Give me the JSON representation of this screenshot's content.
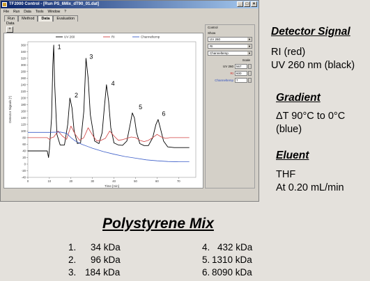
{
  "window": {
    "title": "TF2000 Control - [Run PS_6Mix_dT90_01.dat]",
    "menu": [
      "File",
      "Run",
      "Data",
      "Tools",
      "Window",
      "?"
    ],
    "tabs": [
      "Run",
      "Method",
      "Data",
      "Evaluation"
    ],
    "active_tab": "Data",
    "subtab": "Data",
    "tool_button": "+"
  },
  "control": {
    "title": "Control",
    "show_label": "Show",
    "dropdowns": [
      "UV 260",
      "RI",
      "Channeltemp"
    ],
    "scale_label": "Scale",
    "scales": [
      {
        "name": "UV 260",
        "value": "567",
        "color": "#000000"
      },
      {
        "name": "RI",
        "value": "600",
        "color": "#cc2020"
      },
      {
        "name": "Channeltemp",
        "value": "7",
        "color": "#3050c0"
      }
    ]
  },
  "chart_data": {
    "type": "line",
    "legend": [
      "UV 260",
      "RI",
      "Channeltemp"
    ],
    "legend_position": "top",
    "xlabel": "Time [min]",
    "ylabel": "Detector Signals [*]",
    "xlim": [
      0,
      78
    ],
    "ylim": [
      -40,
      370
    ],
    "xticks": [
      0,
      10,
      20,
      30,
      40,
      50,
      60,
      70
    ],
    "yticks": [
      -40,
      -20,
      0,
      20,
      40,
      60,
      80,
      100,
      120,
      140,
      160,
      180,
      200,
      220,
      240,
      260,
      280,
      300,
      320,
      340,
      360
    ],
    "grid": false,
    "series": [
      {
        "name": "UV 260",
        "color": "#000000",
        "x": [
          0,
          9,
          9.6,
          10,
          11,
          11.6,
          12,
          12.4,
          13.5,
          15,
          17,
          18.5,
          19.5,
          20.5,
          21.5,
          23,
          24.5,
          26,
          27,
          28,
          29,
          31,
          33,
          34.5,
          35.5,
          36.5,
          37.5,
          38.5,
          40,
          42,
          44,
          46,
          47.5,
          48.5,
          49.5,
          50.5,
          52,
          54,
          56,
          58,
          59.5,
          60.5,
          61.5,
          63,
          65,
          68,
          72,
          75
        ],
        "y": [
          40,
          40,
          20,
          45,
          140,
          300,
          360,
          250,
          90,
          58,
          58,
          120,
          200,
          170,
          100,
          62,
          65,
          160,
          320,
          260,
          150,
          70,
          62,
          95,
          170,
          240,
          190,
          110,
          64,
          58,
          57,
          70,
          120,
          155,
          140,
          95,
          62,
          56,
          56,
          80,
          120,
          135,
          110,
          70,
          52,
          50,
          50,
          50
        ]
      },
      {
        "name": "RI",
        "color": "#d04040",
        "x": [
          0,
          9,
          10,
          11,
          12,
          14,
          16,
          18,
          20,
          22,
          24,
          26,
          28,
          30,
          32,
          34,
          36,
          38,
          40,
          42,
          44,
          46,
          48,
          50,
          52,
          54,
          56,
          58,
          60,
          62,
          64,
          66,
          70,
          75
        ],
        "y": [
          80,
          80,
          75,
          80,
          82,
          100,
          85,
          75,
          115,
          90,
          72,
          80,
          110,
          88,
          70,
          72,
          78,
          100,
          85,
          72,
          74,
          78,
          82,
          80,
          72,
          68,
          72,
          80,
          90,
          82,
          78,
          80,
          80,
          80
        ]
      },
      {
        "name": "Channeltemp",
        "color": "#3a5cc8",
        "x": [
          0,
          10,
          15,
          18,
          20,
          22,
          25,
          30,
          35,
          40,
          45,
          50,
          55,
          60,
          65,
          70,
          75
        ],
        "y": [
          96,
          96,
          97,
          93,
          80,
          70,
          60,
          48,
          38,
          30,
          23,
          18,
          13,
          10,
          8,
          7,
          7
        ]
      }
    ],
    "peak_labels": [
      {
        "label": "1",
        "x": 13.8,
        "y": 348
      },
      {
        "label": "2",
        "x": 21.7,
        "y": 202
      },
      {
        "label": "3",
        "x": 28.6,
        "y": 318
      },
      {
        "label": "4",
        "x": 38.7,
        "y": 238
      },
      {
        "label": "5",
        "x": 51.5,
        "y": 166
      },
      {
        "label": "6",
        "x": 62.3,
        "y": 146
      }
    ]
  },
  "annotations": {
    "detector_signal": {
      "heading": "Detector Signal",
      "lines": [
        "RI (red)",
        "UV 260 nm (black)"
      ]
    },
    "gradient": {
      "heading": "Gradient",
      "lines": [
        "ΔT 90°C to 0°C",
        "(blue)"
      ]
    },
    "eluent": {
      "heading": "Eluent",
      "lines": [
        "THF",
        "At 0.20 mL/min"
      ]
    }
  },
  "mix": {
    "title": "Polystyrene Mix",
    "items": [
      {
        "num": "1.",
        "mw": "34 kDa"
      },
      {
        "num": "2.",
        "mw": "96 kDa"
      },
      {
        "num": "3.",
        "mw": "184 kDa"
      },
      {
        "num": "4.",
        "mw": "432 kDa"
      },
      {
        "num": "5.",
        "mw": "1310 kDa"
      },
      {
        "num": "6.",
        "mw": "8090 kDa"
      }
    ]
  }
}
